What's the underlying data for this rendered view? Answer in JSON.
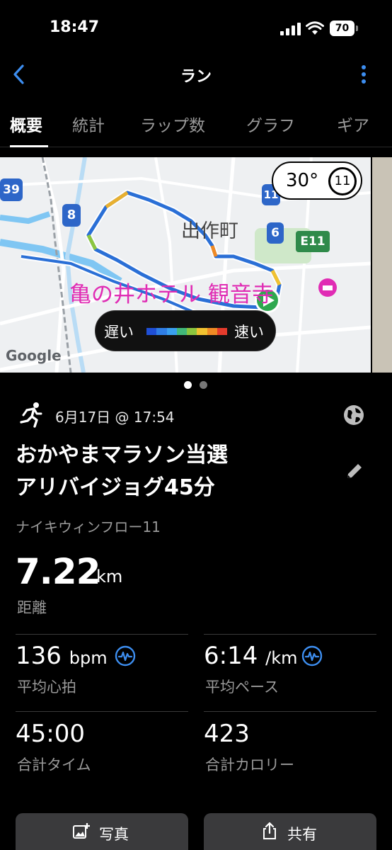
{
  "status_bar": {
    "time": "18:47",
    "battery_level": "70"
  },
  "nav": {
    "title": "ラン"
  },
  "tabs": [
    {
      "label": "概要",
      "active": true
    },
    {
      "label": "統計",
      "active": false
    },
    {
      "label": "ラップ数",
      "active": false
    },
    {
      "label": "グラフ",
      "active": false
    },
    {
      "label": "ギア",
      "active": false
    }
  ],
  "map": {
    "place_label_1": "出作町",
    "place_label_2": "亀の井ホテル 観音寺",
    "route_shield_1": "39",
    "route_shield_2": "8",
    "route_shield_3": "11",
    "route_shield_4": "6",
    "route_shield_5": "E11",
    "google_logo": "Google",
    "weather": {
      "temp": "30°",
      "moon_day": "11"
    },
    "speed_legend": {
      "slow": "遅い",
      "fast": "速い",
      "colors": [
        "#1f4fd6",
        "#2f7ee6",
        "#3aa0f0",
        "#42b87a",
        "#8cc63f",
        "#f2c230",
        "#f08a24",
        "#e53b2c"
      ]
    },
    "page_dots": {
      "count": 2,
      "active_index": 0
    }
  },
  "activity": {
    "datetime": "6月17日 @ 17:54",
    "title_line1": "おかやまマラソン当選",
    "title_line2": "アリバイジョグ45分",
    "shoe": "ナイキウィンフロー11",
    "distance": {
      "value": "7.22",
      "unit": "km",
      "label": "距離"
    }
  },
  "stats": {
    "heart_rate": {
      "value": "136",
      "unit": "bpm",
      "label": "平均心拍"
    },
    "pace": {
      "value": "6:14",
      "unit": "/km",
      "label": "平均ペース"
    },
    "time": {
      "value": "45:00",
      "label": "合計タイム"
    },
    "calories": {
      "value": "423",
      "label": "合計カロリー"
    }
  },
  "buttons": {
    "photo": "写真",
    "share": "共有"
  },
  "colors": {
    "accent_blue": "#3d8ef0",
    "background": "#000000",
    "muted_text": "#9a9a9a",
    "button_bg": "#3a3a3c"
  }
}
